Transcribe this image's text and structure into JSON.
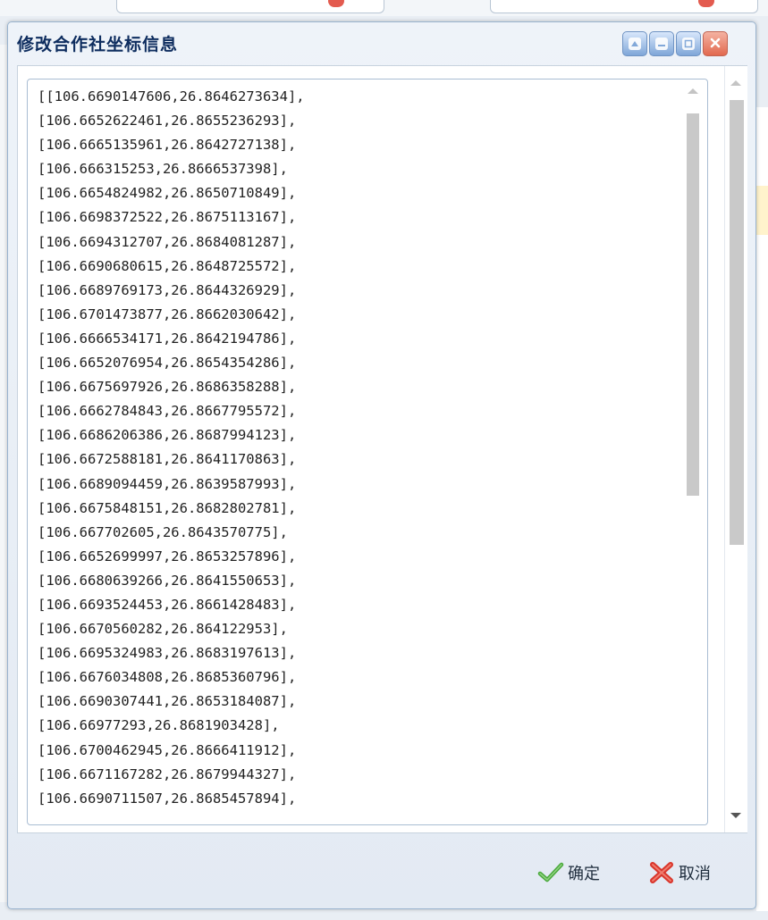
{
  "dialog": {
    "title": "修改合作社坐标信息",
    "coordinates_text": "[[106.6690147606,26.8646273634],\n[106.6652622461,26.8655236293],\n[106.6665135961,26.8642727138],\n[106.666315253,26.8666537398],\n[106.6654824982,26.8650710849],\n[106.6698372522,26.8675113167],\n[106.6694312707,26.8684081287],\n[106.6690680615,26.8648725572],\n[106.6689769173,26.8644326929],\n[106.6701473877,26.8662030642],\n[106.6666534171,26.8642194786],\n[106.6652076954,26.8654354286],\n[106.6675697926,26.8686358288],\n[106.6662784843,26.8667795572],\n[106.6686206386,26.8687994123],\n[106.6672588181,26.8641170863],\n[106.6689094459,26.8639587993],\n[106.6675848151,26.8682802781],\n[106.667702605,26.8643570775],\n[106.6652699997,26.8653257896],\n[106.6680639266,26.8641550653],\n[106.6693524453,26.8661428483],\n[106.6670560282,26.864122953],\n[106.6695324983,26.8683197613],\n[106.6676034808,26.8685360796],\n[106.6690307441,26.8653184087],\n[106.66977293,26.8681903428],\n[106.6700462945,26.8666411912],\n[106.6671167282,26.8679944327],\n[106.6690711507,26.8685457894],",
    "ok_label": "确定",
    "cancel_label": "取消"
  },
  "colors": {
    "title": "#0e2d5f",
    "ok_icon": "#49a83b",
    "cancel_icon": "#d9352b"
  },
  "icons": [
    "collapse-icon",
    "minimize-icon",
    "maximize-icon",
    "close-icon",
    "check-icon",
    "cross-icon"
  ]
}
